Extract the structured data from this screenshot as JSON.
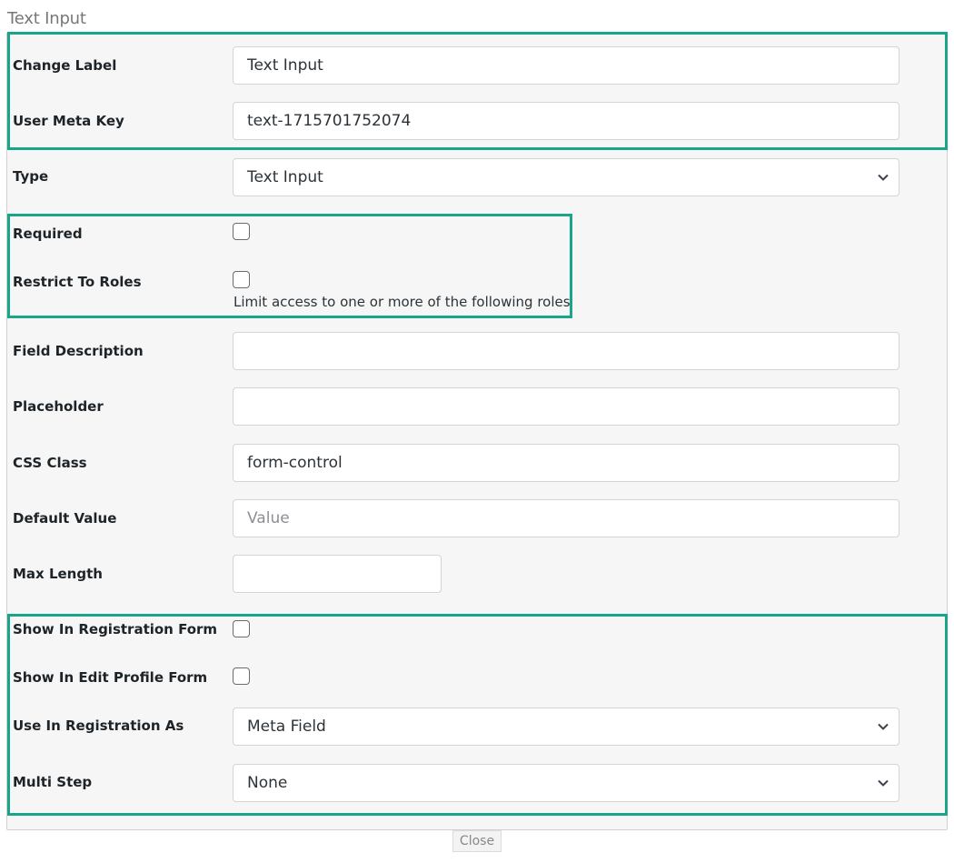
{
  "title": "Text Input",
  "fields": {
    "change_label": {
      "label": "Change Label",
      "value": "Text Input"
    },
    "user_meta_key": {
      "label": "User Meta Key",
      "value": "text-1715701752074"
    },
    "type": {
      "label": "Type",
      "value": "Text Input"
    },
    "required": {
      "label": "Required",
      "checked": false
    },
    "restrict_to_roles": {
      "label": "Restrict To Roles",
      "checked": false,
      "help": "Limit access to one or more of the following roles"
    },
    "field_description": {
      "label": "Field Description",
      "value": ""
    },
    "placeholder": {
      "label": "Placeholder",
      "value": ""
    },
    "css_class": {
      "label": "CSS Class",
      "value": "form-control"
    },
    "default_value": {
      "label": "Default Value",
      "value": "",
      "placeholder": "Value"
    },
    "max_length": {
      "label": "Max Length",
      "value": ""
    },
    "show_in_registration": {
      "label": "Show In Registration Form",
      "checked": false
    },
    "show_in_edit_profile": {
      "label": "Show In Edit Profile Form",
      "checked": false
    },
    "use_in_registration_as": {
      "label": "Use In Registration As",
      "value": "Meta Field"
    },
    "multi_step": {
      "label": "Multi Step",
      "value": "None"
    }
  },
  "close_label": "Close",
  "colors": {
    "highlight": "#1aa58a",
    "panel_bg": "#f6f6f6"
  },
  "icons": {
    "select_arrow": "chevron-down-icon"
  }
}
